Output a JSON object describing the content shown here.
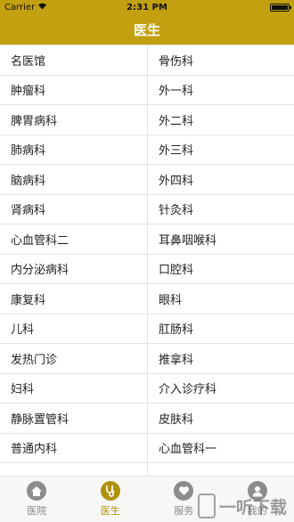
{
  "status_bar": {
    "carrier": "Carrier",
    "time": "2:31 PM"
  },
  "nav": {
    "title": "医生"
  },
  "departments": [
    [
      "名医馆",
      "骨伤科"
    ],
    [
      "肿瘤科",
      "外一科"
    ],
    [
      "脾胃病科",
      "外二科"
    ],
    [
      "肺病科",
      "外三科"
    ],
    [
      "脑病科",
      "外四科"
    ],
    [
      "肾病科",
      "针灸科"
    ],
    [
      "心血管科二",
      "耳鼻咽喉科"
    ],
    [
      "内分泌病科",
      "口腔科"
    ],
    [
      "康复科",
      "眼科"
    ],
    [
      "儿科",
      "肛肠科"
    ],
    [
      "发热门诊",
      "推拿科"
    ],
    [
      "妇科",
      "介入诊疗科"
    ],
    [
      "静脉置管科",
      "皮肤科"
    ],
    [
      "普通内科",
      "心血管科一"
    ],
    [
      "",
      ""
    ]
  ],
  "tabs": [
    {
      "label": "医院",
      "icon": "home-icon",
      "active": false
    },
    {
      "label": "医生",
      "icon": "stethoscope-icon",
      "active": true
    },
    {
      "label": "服务",
      "icon": "heart-icon",
      "active": false
    },
    {
      "label": "我的",
      "icon": "person-icon",
      "active": false
    }
  ],
  "watermark": {
    "text": "一听下载"
  },
  "colors": {
    "brand": "#c2a010",
    "active_tab": "#b0920b"
  }
}
